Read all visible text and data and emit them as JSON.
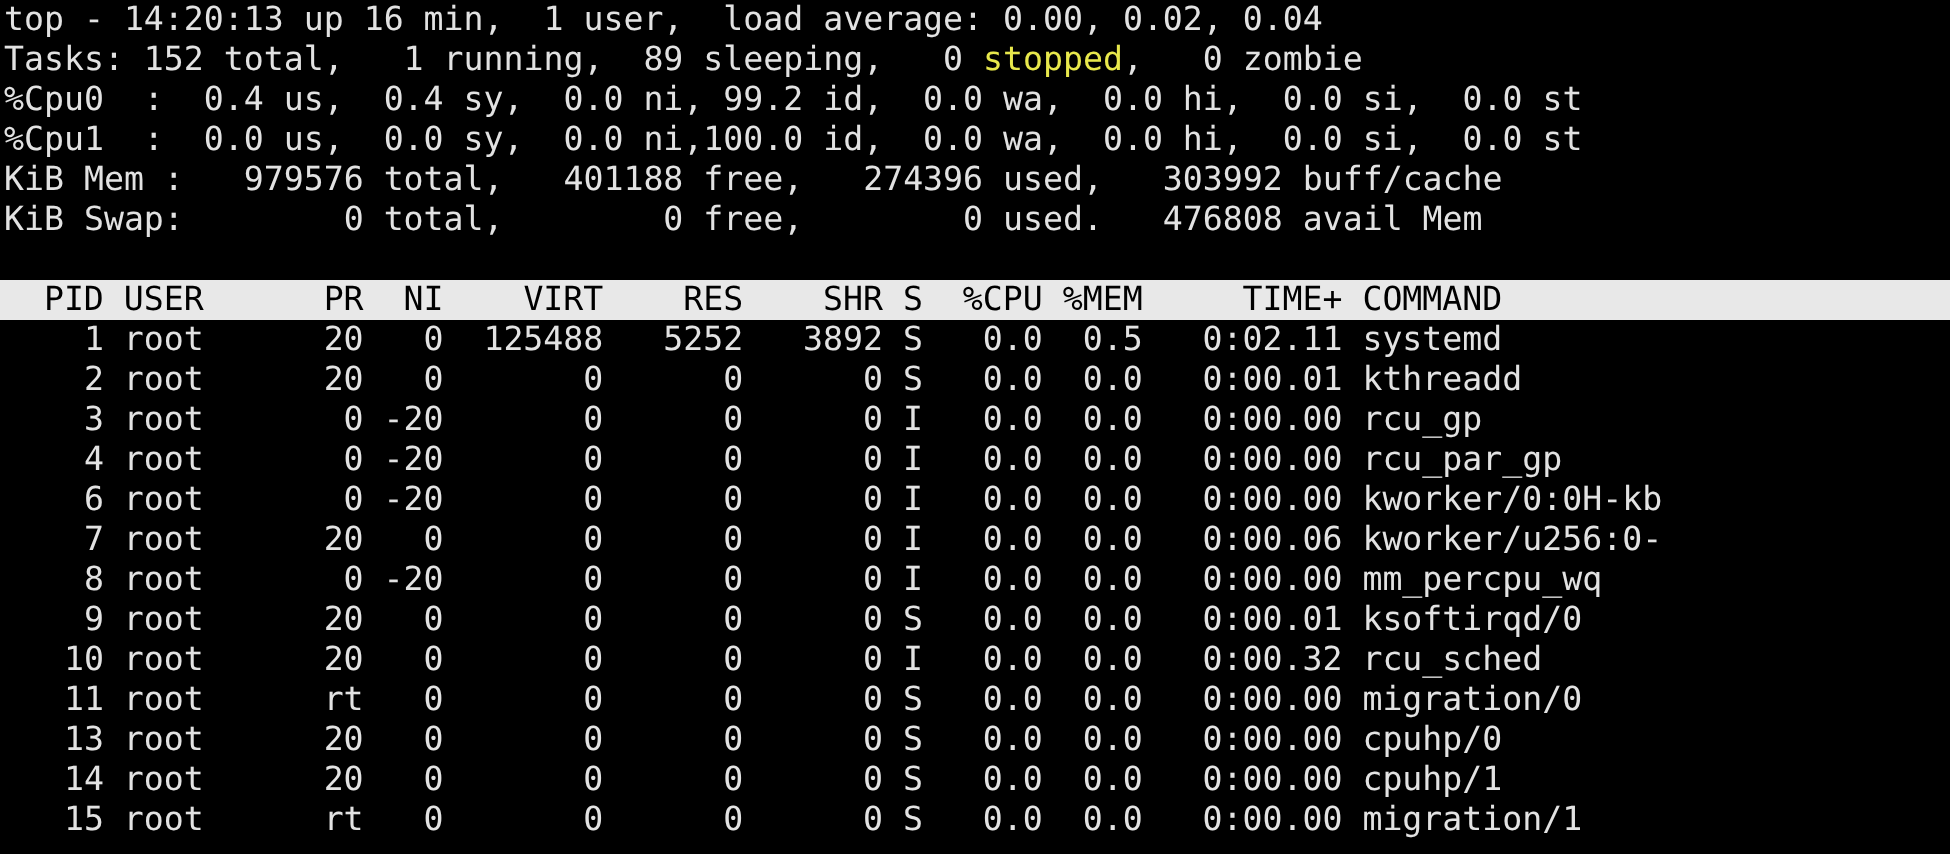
{
  "summary": [
    {
      "segments": [
        {
          "text": "top - 14:20:13 up 16 min,  1 user,  load average: 0.00, 0.02, 0.04",
          "highlighted": false
        }
      ]
    },
    {
      "segments": [
        {
          "text": "Tasks: 152 total,   1 running,  89 sleeping,   0 ",
          "highlighted": false
        },
        {
          "text": "stopped",
          "highlighted": true
        },
        {
          "text": ",   0 zombie",
          "highlighted": false
        }
      ]
    },
    {
      "segments": [
        {
          "text": "%Cpu0  :  0.4 us,  0.4 sy,  0.0 ni, 99.2 id,  0.0 wa,  0.0 hi,  0.0 si,  0.0 st",
          "highlighted": false
        }
      ]
    },
    {
      "segments": [
        {
          "text": "%Cpu1  :  0.0 us,  0.0 sy,  0.0 ni,100.0 id,  0.0 wa,  0.0 hi,  0.0 si,  0.0 st",
          "highlighted": false
        }
      ]
    },
    {
      "segments": [
        {
          "text": "KiB Mem :   979576 total,   401188 free,   274396 used,   303992 buff/cache",
          "highlighted": false
        }
      ]
    },
    {
      "segments": [
        {
          "text": "KiB Swap:        0 total,        0 free,        0 used.   476808 avail Mem",
          "highlighted": false
        }
      ]
    }
  ],
  "table": {
    "columns": [
      "PID",
      "USER",
      "PR",
      "NI",
      "VIRT",
      "RES",
      "SHR",
      "S",
      "%CPU",
      "%MEM",
      "TIME+",
      "COMMAND"
    ],
    "rows": [
      [
        "1",
        "root",
        "20",
        "0",
        "125488",
        "5252",
        "3892",
        "S",
        "0.0",
        "0.5",
        "0:02.11",
        "systemd"
      ],
      [
        "2",
        "root",
        "20",
        "0",
        "0",
        "0",
        "0",
        "S",
        "0.0",
        "0.0",
        "0:00.01",
        "kthreadd"
      ],
      [
        "3",
        "root",
        "0",
        "-20",
        "0",
        "0",
        "0",
        "I",
        "0.0",
        "0.0",
        "0:00.00",
        "rcu_gp"
      ],
      [
        "4",
        "root",
        "0",
        "-20",
        "0",
        "0",
        "0",
        "I",
        "0.0",
        "0.0",
        "0:00.00",
        "rcu_par_gp"
      ],
      [
        "6",
        "root",
        "0",
        "-20",
        "0",
        "0",
        "0",
        "I",
        "0.0",
        "0.0",
        "0:00.00",
        "kworker/0:0H-kb"
      ],
      [
        "7",
        "root",
        "20",
        "0",
        "0",
        "0",
        "0",
        "I",
        "0.0",
        "0.0",
        "0:00.06",
        "kworker/u256:0-"
      ],
      [
        "8",
        "root",
        "0",
        "-20",
        "0",
        "0",
        "0",
        "I",
        "0.0",
        "0.0",
        "0:00.00",
        "mm_percpu_wq"
      ],
      [
        "9",
        "root",
        "20",
        "0",
        "0",
        "0",
        "0",
        "S",
        "0.0",
        "0.0",
        "0:00.01",
        "ksoftirqd/0"
      ],
      [
        "10",
        "root",
        "20",
        "0",
        "0",
        "0",
        "0",
        "I",
        "0.0",
        "0.0",
        "0:00.32",
        "rcu_sched"
      ],
      [
        "11",
        "root",
        "rt",
        "0",
        "0",
        "0",
        "0",
        "S",
        "0.0",
        "0.0",
        "0:00.00",
        "migration/0"
      ],
      [
        "13",
        "root",
        "20",
        "0",
        "0",
        "0",
        "0",
        "S",
        "0.0",
        "0.0",
        "0:00.00",
        "cpuhp/0"
      ],
      [
        "14",
        "root",
        "20",
        "0",
        "0",
        "0",
        "0",
        "S",
        "0.0",
        "0.0",
        "0:00.00",
        "cpuhp/1"
      ],
      [
        "15",
        "root",
        "rt",
        "0",
        "0",
        "0",
        "0",
        "S",
        "0.0",
        "0.0",
        "0:00.00",
        "migration/1"
      ]
    ]
  }
}
